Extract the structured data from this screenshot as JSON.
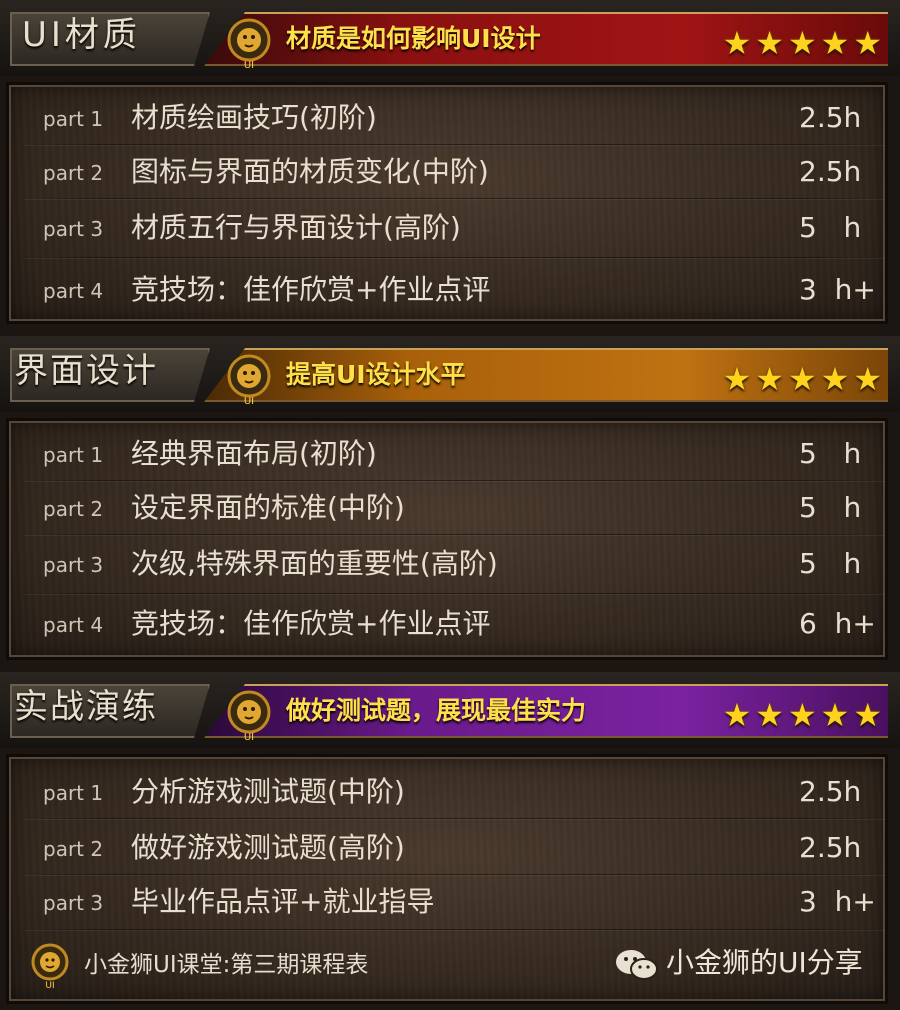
{
  "sections": [
    {
      "tab_label": "UI材质",
      "banner_title": "材质是如何影响UI设计",
      "banner_color": "red",
      "stars": 5,
      "rows": [
        {
          "part": "part 1",
          "title": "材质绘画技巧(初阶)",
          "hours": "2.5h"
        },
        {
          "part": "part 2",
          "title": "图标与界面的材质变化(中阶)",
          "hours": "2.5h"
        },
        {
          "part": "part 3",
          "title": "材质五行与界面设计(高阶)",
          "hours": "5   h"
        },
        {
          "part": "part 4",
          "title": "竞技场：佳作欣赏+作业点评",
          "hours": "3  h+"
        }
      ]
    },
    {
      "tab_label": "界面设计",
      "banner_title": "提高UI设计水平",
      "banner_color": "orange",
      "stars": 5,
      "rows": [
        {
          "part": "part 1",
          "title": "经典界面布局(初阶)",
          "hours": "5   h"
        },
        {
          "part": "part 2",
          "title": "设定界面的标准(中阶)",
          "hours": "5   h"
        },
        {
          "part": "part 3",
          "title": "次级,特殊界面的重要性(高阶)",
          "hours": "5   h"
        },
        {
          "part": "part 4",
          "title": "竞技场：佳作欣赏+作业点评",
          "hours": "6  h+"
        }
      ]
    },
    {
      "tab_label": "实战演练",
      "banner_title": "做好测试题，展现最佳实力",
      "banner_color": "purple",
      "stars": 5,
      "rows": [
        {
          "part": "part 1",
          "title": "分析游戏测试题(中阶)",
          "hours": "2.5h"
        },
        {
          "part": "part 2",
          "title": "做好游戏测试题(高阶)",
          "hours": "2.5h"
        },
        {
          "part": "part 3",
          "title": "毕业作品点评+就业指导",
          "hours": "3  h+"
        }
      ]
    }
  ],
  "footer": {
    "caption": "小金狮UI课堂:第三期课程表",
    "brand": "小金狮的UI分享",
    "lion_badge": "UI",
    "lion_icon": "lion-logo-icon",
    "wechat_icon": "wechat-icon"
  },
  "star_glyph": "★",
  "colors": {
    "star": "#ffd21e",
    "banner_title": "#ffe04a",
    "red_banner": "#a01414",
    "orange_banner": "#c07212",
    "purple_banner": "#7a22a0"
  }
}
